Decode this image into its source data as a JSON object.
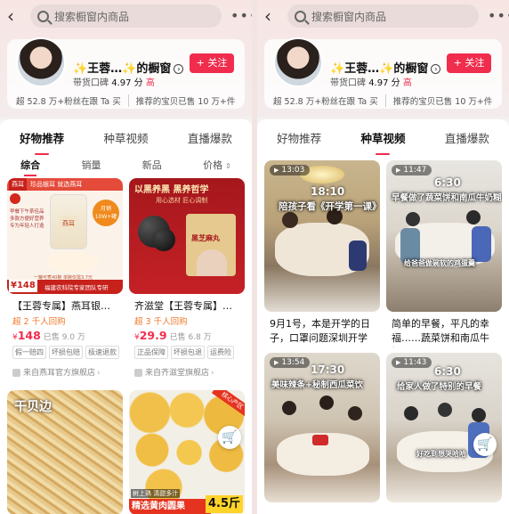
{
  "left": {
    "search_placeholder": "搜索橱窗内商品",
    "shop_name": "✨王蓉…✨的橱窗",
    "follow_label": "+ 关注",
    "reputation_label": "带货口碑",
    "reputation_score": "4.97 分",
    "reputation_level": "高",
    "fans_text": "超 52.8 万+粉丝在跟 Ta 买",
    "recommend_text": "推荐的宝贝已售 10 万+件",
    "tabs": [
      {
        "label": "好物推荐"
      },
      {
        "label": "种草视频"
      },
      {
        "label": "直播爆款"
      }
    ],
    "sort": [
      {
        "label": "综合"
      },
      {
        "label": "销量"
      },
      {
        "label": "新品"
      },
      {
        "label": "价格"
      }
    ],
    "products": [
      {
        "title": "【王蓉专属】燕耳银耳…",
        "sub": "超 2 千人回购",
        "currency": "¥",
        "price": "148",
        "sold": "已售 9.0 万",
        "tags": [
          "假一赔四",
          "坏损包赔",
          "极速退款"
        ],
        "shop": "来自燕耳官方旗舰店"
      },
      {
        "title": "齐滋堂【王蓉专属】臻…",
        "sub": "超 3 千人回购",
        "currency": "¥",
        "price": "29.9",
        "sold": "已售 6.8 万",
        "tags": [
          "正品保障",
          "坏损包退",
          "运费险"
        ],
        "shop": "来自齐滋堂旗舰店"
      }
    ],
    "img1": {
      "brand": "燕耳",
      "line1": "珍品银耳 就选燕耳",
      "badge": "月销 10W+罐",
      "promo_price": "¥148",
      "promo_label": "福建农科院专家团队专研",
      "deal": "一罐可煮40碗 单碗仅需3.7元",
      "bullets": [
        "早餐下午茶佳品",
        "多款方便好营养",
        "专为年轻人打造"
      ]
    },
    "img2": {
      "headline": "以黑养黑 黑养哲学",
      "sub": "用心选材 匠心调制",
      "jar_label": "黑芝麻丸"
    },
    "img3": {
      "label": "干贝边"
    },
    "img4": {
      "ribbon": "精选黄肉圆果",
      "price": "4.5斤",
      "corner": "核心产区",
      "note": "树上熟 清甜多汁"
    }
  },
  "right": {
    "search_placeholder": "搜索橱窗内商品",
    "shop_name": "✨王蓉…✨的橱窗",
    "follow_label": "+ 关注",
    "reputation_label": "带货口碑",
    "reputation_score": "4.97 分",
    "reputation_level": "高",
    "fans_text": "超 52.8 万+粉丝在跟 Ta 买",
    "recommend_text": "推荐的宝贝已售 10 万+件",
    "tabs": [
      {
        "label": "好物推荐"
      },
      {
        "label": "种草视频"
      },
      {
        "label": "直播爆款"
      }
    ],
    "videos": [
      {
        "duration": "13:03",
        "clock": "18:10",
        "caption": "陪孩子看《开学第一课》",
        "title": "9月1号，本是开学的日子，口罩问题深圳开学又…"
      },
      {
        "duration": "11:47",
        "clock": "6:30",
        "caption": "早餐做了蔬菜饼和南瓜牛奶糊",
        "subcaption": "给爸爸做碗软的鸡蛋羹",
        "title": "简单的早餐，平凡的幸福……蔬菜饼和南瓜牛奶…"
      },
      {
        "duration": "13:54",
        "clock": "17:30",
        "caption": "美味辣条+秘制西瓜菜饮",
        "title": ""
      },
      {
        "duration": "11:43",
        "clock": "6:30",
        "caption": "给家人做了特别的早餐",
        "subcaption": "好吃到想哭哈哈",
        "title": ""
      }
    ]
  },
  "colors": {
    "accent": "#f02d4d",
    "orange": "#f07a2d"
  }
}
